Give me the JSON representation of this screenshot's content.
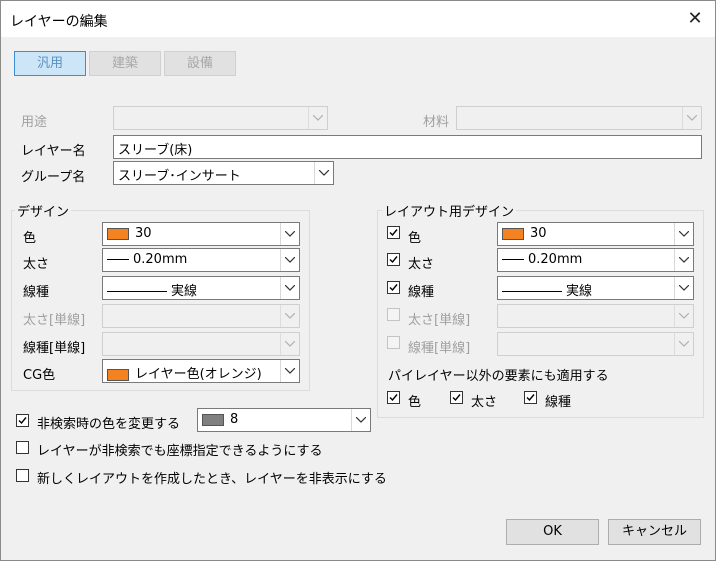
{
  "window": {
    "title": "レイヤーの編集"
  },
  "tabs": [
    {
      "label": "汎用",
      "active": true
    },
    {
      "label": "建築",
      "active": false
    },
    {
      "label": "設備",
      "active": false
    }
  ],
  "fields": {
    "usage_label": "用途",
    "usage_value": "",
    "material_label": "材料",
    "material_value": "",
    "layer_name_label": "レイヤー名",
    "layer_name_value": "スリーブ(床)",
    "group_name_label": "グループ名",
    "group_name_value": "スリーブ･インサート"
  },
  "design": {
    "title": "デザイン",
    "color_label": "色",
    "color_value": "30",
    "color_swatch": "#f58220",
    "thickness_label": "太さ",
    "thickness_value": "0.20mm",
    "linetype_label": "線種",
    "linetype_value": "実線",
    "single_thickness_label": "太さ[単線]",
    "single_linetype_label": "線種[単線]",
    "cg_color_label": "CG色",
    "cg_color_value": "レイヤー色(オレンジ)",
    "cg_color_swatch": "#f58220"
  },
  "layout_design": {
    "title": "レイアウト用デザイン",
    "color_label": "色",
    "color_checked": true,
    "color_value": "30",
    "color_swatch": "#f58220",
    "thickness_label": "太さ",
    "thickness_checked": true,
    "thickness_value": "0.20mm",
    "linetype_label": "線種",
    "linetype_checked": true,
    "linetype_value": "実線",
    "single_thickness_label": "太さ[単線]",
    "single_linetype_label": "線種[単線]",
    "apply_label": "パイレイヤー以外の要素にも適用する",
    "apply_color_label": "色",
    "apply_thickness_label": "太さ",
    "apply_linetype_label": "線種"
  },
  "options": {
    "change_color_label": "非検索時の色を変更する",
    "change_color_checked": true,
    "change_color_value": "8",
    "change_color_swatch": "#808080",
    "coord_label": "レイヤーが非検索でも座標指定できるようにする",
    "coord_checked": false,
    "hide_label": "新しくレイアウトを作成したとき、レイヤーを非表示にする",
    "hide_checked": false
  },
  "buttons": {
    "ok": "OK",
    "cancel": "キャンセル"
  }
}
